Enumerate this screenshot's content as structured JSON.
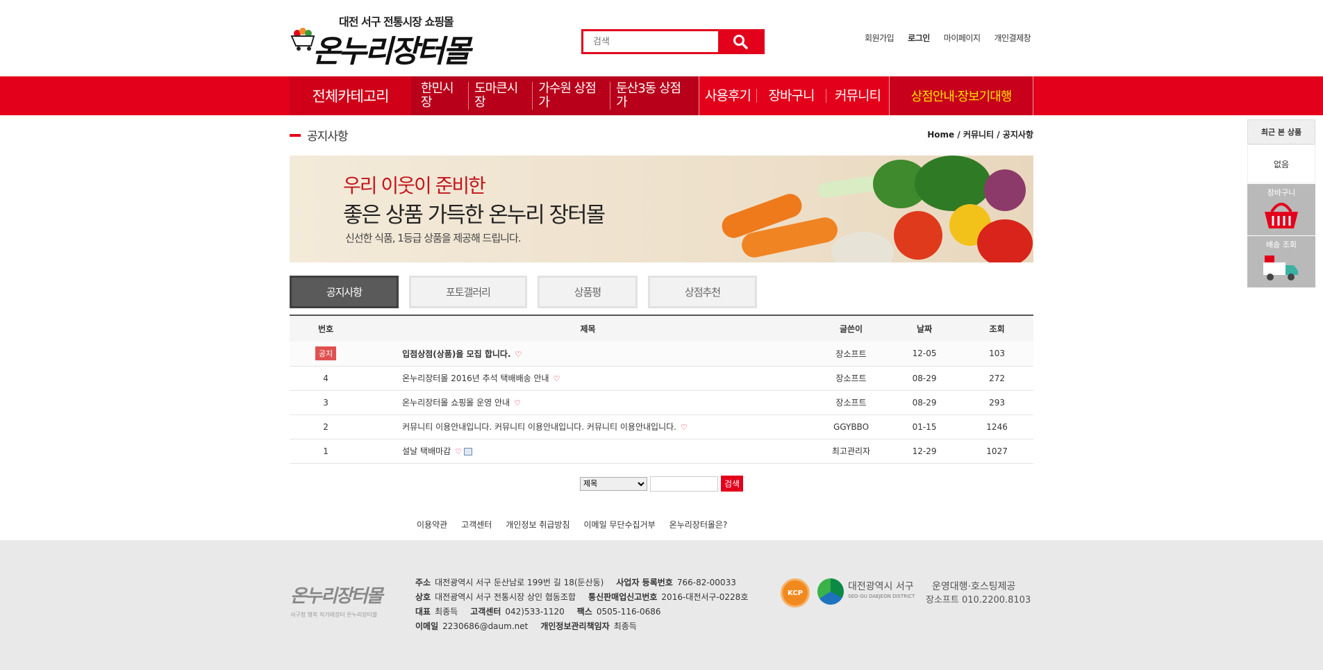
{
  "header": {
    "logo_sub": "대전 서구 전통시장 쇼핑몰",
    "logo_main": "온누리장터몰",
    "search_placeholder": "검색",
    "top_links": [
      "회원가입",
      "로그인",
      "마이페이지",
      "개인결제창"
    ]
  },
  "nav": {
    "all_category": "전체카테고리",
    "markets": [
      "한민시장",
      "도마큰시장",
      "가수원 상점가",
      "둔산3동 상점가"
    ],
    "menus": [
      "사용후기",
      "장바구니",
      "커뮤니티"
    ],
    "store": "상점안내·장보기대행"
  },
  "page": {
    "title": "공지사항",
    "breadcrumb": "Home / 커뮤니티 / 공지사항"
  },
  "banner": {
    "line1": "우리 이웃이 준비한",
    "line2": "좋은 상품 가득한 온누리 장터몰",
    "line3": "신선한 식품, 1등급 상품을 제공해 드립니다."
  },
  "tabs": [
    "공지사항",
    "포토갤러리",
    "상품평",
    "상점추천"
  ],
  "board": {
    "columns": [
      "번호",
      "제목",
      "글쓴이",
      "날짜",
      "조회"
    ],
    "rows": [
      {
        "no": "공지",
        "subject": "입점상점(상품)을 모집 합니다.",
        "writer": "장소프트",
        "date": "12-05",
        "views": "103"
      },
      {
        "no": "4",
        "subject": "온누리장터몰 2016년 추석 택배배송 안내",
        "writer": "장소프트",
        "date": "08-29",
        "views": "272"
      },
      {
        "no": "3",
        "subject": "온누리장터몰 쇼핑몰 운영 안내",
        "writer": "장소프트",
        "date": "08-29",
        "views": "293"
      },
      {
        "no": "2",
        "subject": "커뮤니티 이용안내입니다. 커뮤니티 이용안내입니다. 커뮤니티 이용안내입니다.",
        "writer": "GGYBBO",
        "date": "01-15",
        "views": "1246"
      },
      {
        "no": "1",
        "subject": "설날 택배마감",
        "writer": "최고관리자",
        "date": "12-29",
        "views": "1027"
      }
    ]
  },
  "search": {
    "select_value": "제목",
    "button": "검색"
  },
  "footer_links": [
    "이용약관",
    "고객센터",
    "개인정보 취급방침",
    "이메일 무단수집거부",
    "온누리장터몰은?"
  ],
  "footer": {
    "logo": "온누리장터몰",
    "logo_sub": "서구청 행복 직거래장터 온누리장터몰",
    "address_label": "주소",
    "address": "대전광역시 서구 둔산남로 199번 길 18(둔산동)",
    "bizno_label": "사업자 등록번호",
    "bizno": "766-82-00033",
    "company_label": "상호",
    "company": "대전광역시 서구 전통시장 상인 협동조합",
    "telecom_label": "통신판매업신고번호",
    "telecom": "2016-대전서구-0228호",
    "ceo_label": "대표",
    "ceo": "최종득",
    "cs_label": "고객센터",
    "cs": "042)533-1120",
    "fax_label": "팩스",
    "fax": "0505-116-0686",
    "email_label": "이메일",
    "email": "2230686@daum.net",
    "privacy_label": "개인정보관리책임자",
    "privacy": "최종득",
    "kcp": "KCP",
    "seogu": "대전광역시 서구",
    "seogu_en": "SEO-GU DAEJEON DISTRICT",
    "ops": "운영대행·호스팅제공",
    "ops_contact": "장소프트 010.2200.8103"
  },
  "quick": {
    "recent_title": "최근 본 상품",
    "recent_empty": "없음",
    "cart": "장바구니",
    "delivery": "배송 조회"
  }
}
